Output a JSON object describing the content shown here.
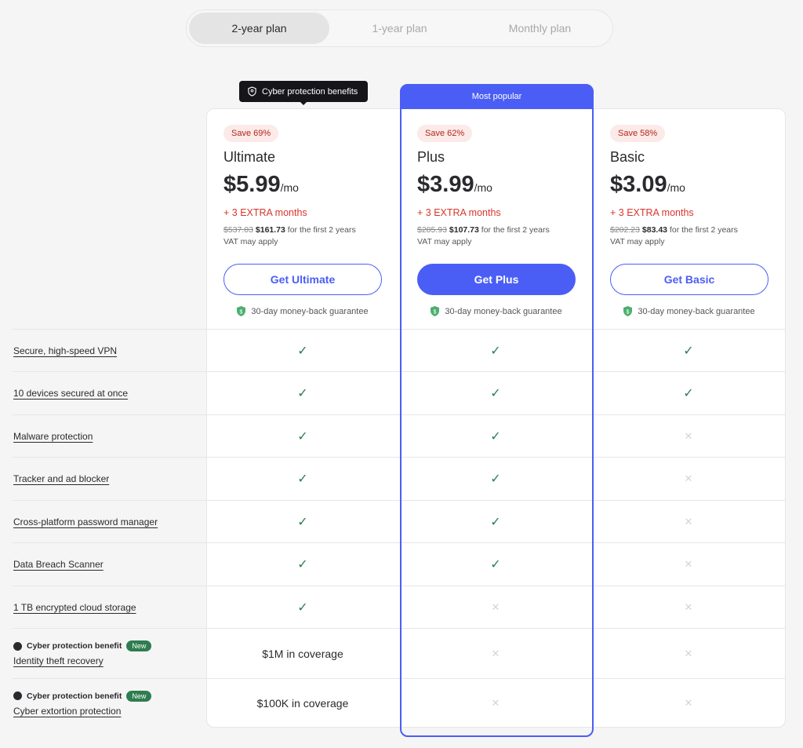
{
  "tabs": [
    {
      "label": "2-year plan",
      "active": true
    },
    {
      "label": "1-year plan",
      "active": false
    },
    {
      "label": "Monthly plan",
      "active": false
    }
  ],
  "tooltip": "Cyber protection benefits",
  "most_popular": "Most popular",
  "plans": [
    {
      "save": "Save 69%",
      "name": "Ultimate",
      "price": "$5.99",
      "per": "/mo",
      "extra": "+ 3 EXTRA months",
      "old": "$537.03",
      "new": "$161.73",
      "term": " for the first 2 years",
      "vat": "VAT may apply",
      "button": "Get Ultimate",
      "guarantee": "30-day money-back guarantee"
    },
    {
      "save": "Save 62%",
      "name": "Plus",
      "price": "$3.99",
      "per": "/mo",
      "extra": "+ 3 EXTRA months",
      "old": "$285.93",
      "new": "$107.73",
      "term": " for the first 2 years",
      "vat": "VAT may apply",
      "button": "Get Plus",
      "guarantee": "30-day money-back guarantee"
    },
    {
      "save": "Save 58%",
      "name": "Basic",
      "price": "$3.09",
      "per": "/mo",
      "extra": "+ 3 EXTRA months",
      "old": "$202.23",
      "new": "$83.43",
      "term": " for the first 2 years",
      "vat": "VAT may apply",
      "button": "Get Basic",
      "guarantee": "30-day money-back guarantee"
    }
  ],
  "cyber_label": "Cyber protection benefit",
  "new_badge": "New",
  "features": [
    {
      "label": "Secure, high-speed VPN",
      "values": [
        "check",
        "check",
        "check"
      ]
    },
    {
      "label": "10 devices secured at once",
      "values": [
        "check",
        "check",
        "check"
      ]
    },
    {
      "label": "Malware protection",
      "values": [
        "check",
        "check",
        "cross"
      ]
    },
    {
      "label": "Tracker and ad blocker",
      "values": [
        "check",
        "check",
        "cross"
      ]
    },
    {
      "label": "Cross-platform password manager",
      "values": [
        "check",
        "check",
        "cross"
      ]
    },
    {
      "label": "Data Breach Scanner",
      "values": [
        "check",
        "check",
        "cross"
      ]
    },
    {
      "label": "1 TB encrypted cloud storage",
      "values": [
        "check",
        "cross",
        "cross"
      ]
    },
    {
      "label": "Identity theft recovery",
      "cyber": true,
      "values": [
        "$1M in coverage",
        "cross",
        "cross"
      ]
    },
    {
      "label": "Cyber extortion protection",
      "cyber": true,
      "values": [
        "$100K in coverage",
        "cross",
        "cross"
      ]
    }
  ],
  "colors": {
    "accent": "#4a5ef5",
    "check": "#2e7d4f",
    "extra": "#d8362a",
    "save_bg": "#fbeae8"
  }
}
